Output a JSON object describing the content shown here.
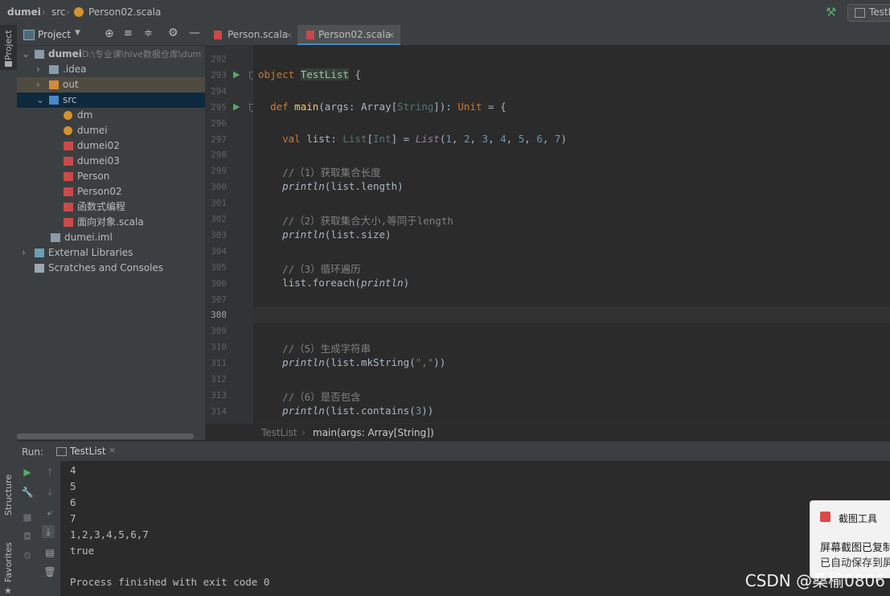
{
  "breadcrumb": {
    "project": "dumei",
    "folder": "src",
    "file": "Person02.scala"
  },
  "run_config": "TestL",
  "left_strip": {
    "project": "Project",
    "structure": "Structure",
    "favorites": "Favorites"
  },
  "project_panel": {
    "title": "Project",
    "items": [
      {
        "label": "dumei",
        "path": "D:\\专业课\\hive数据仓库\\dum",
        "arrow": "⌄",
        "icon": "folder-icon"
      },
      {
        "label": ".idea",
        "arrow": "›",
        "icon": "folder-icon"
      },
      {
        "label": "out",
        "arrow": "›",
        "icon": "folder-orange-icon"
      },
      {
        "label": "src",
        "arrow": "⌄",
        "icon": "folder-blue-icon"
      },
      {
        "label": "dm",
        "icon": "scala-object-icon"
      },
      {
        "label": "dumei",
        "icon": "scala-object-icon"
      },
      {
        "label": "dumei02",
        "icon": "scala-file-icon"
      },
      {
        "label": "dumei03",
        "icon": "scala-file-icon"
      },
      {
        "label": "Person",
        "icon": "scala-file-icon"
      },
      {
        "label": "Person02",
        "icon": "scala-file-icon"
      },
      {
        "label": "函数式编程",
        "icon": "scala-file-icon"
      },
      {
        "label": "面向对象.scala",
        "icon": "scala-file-error-icon"
      },
      {
        "label": "dumei.iml",
        "icon": "iml-file-icon"
      },
      {
        "label": "External Libraries",
        "arrow": "›",
        "icon": "library-icon"
      },
      {
        "label": "Scratches and Consoles",
        "icon": "scratches-icon"
      }
    ]
  },
  "tabs": [
    {
      "label": "Person.scala",
      "active": false
    },
    {
      "label": "Person02.scala",
      "active": true
    }
  ],
  "editor": {
    "lines": [
      {
        "num": "292",
        "text": ""
      },
      {
        "num": "293",
        "tokens": [
          [
            "kw",
            "object "
          ],
          [
            "hl",
            "TestList"
          ],
          [
            "pl",
            " {"
          ]
        ]
      },
      {
        "num": "294",
        "text": ""
      },
      {
        "num": "295",
        "tokens": [
          [
            "pl",
            "  "
          ],
          [
            "kw",
            "def "
          ],
          [
            "fn",
            "main"
          ],
          [
            "pl",
            "(args: Array["
          ],
          [
            "ty",
            "String"
          ],
          [
            "pl",
            "]): "
          ],
          [
            "kw",
            "Unit"
          ],
          [
            "pl",
            " = {"
          ]
        ]
      },
      {
        "num": "296",
        "text": ""
      },
      {
        "num": "297",
        "tokens": [
          [
            "pl",
            "    "
          ],
          [
            "kw",
            "val "
          ],
          [
            "pl",
            "list: "
          ],
          [
            "ty",
            "List"
          ],
          [
            "pl",
            "["
          ],
          [
            "ty",
            "Int"
          ],
          [
            "pl",
            "] = "
          ],
          [
            "it",
            "List"
          ],
          [
            "pl",
            "("
          ],
          [
            "nm",
            "1"
          ],
          [
            "pl",
            ", "
          ],
          [
            "nm",
            "2"
          ],
          [
            "pl",
            ", "
          ],
          [
            "nm",
            "3"
          ],
          [
            "pl",
            ", "
          ],
          [
            "nm",
            "4"
          ],
          [
            "pl",
            ", "
          ],
          [
            "nm",
            "5"
          ],
          [
            "pl",
            ", "
          ],
          [
            "nm",
            "6"
          ],
          [
            "pl",
            ", "
          ],
          [
            "nm",
            "7"
          ],
          [
            "pl",
            ")"
          ]
        ]
      },
      {
        "num": "298",
        "text": ""
      },
      {
        "num": "299",
        "tokens": [
          [
            "pl",
            "    "
          ],
          [
            "cm",
            "//（1）获取集合长度"
          ]
        ]
      },
      {
        "num": "300",
        "tokens": [
          [
            "pl",
            "    "
          ],
          [
            "pi",
            "println"
          ],
          [
            "pl",
            "(list.length)"
          ]
        ]
      },
      {
        "num": "301",
        "text": ""
      },
      {
        "num": "302",
        "tokens": [
          [
            "pl",
            "    "
          ],
          [
            "cm",
            "//（2）获取集合大小,等同于length"
          ]
        ]
      },
      {
        "num": "303",
        "tokens": [
          [
            "pl",
            "    "
          ],
          [
            "pi",
            "println"
          ],
          [
            "pl",
            "(list.size)"
          ]
        ]
      },
      {
        "num": "304",
        "text": ""
      },
      {
        "num": "305",
        "tokens": [
          [
            "pl",
            "    "
          ],
          [
            "cm",
            "//（3）循环遍历"
          ]
        ]
      },
      {
        "num": "306",
        "tokens": [
          [
            "pl",
            "    list.foreach("
          ],
          [
            "pi",
            "println"
          ],
          [
            "pl",
            ")"
          ]
        ]
      },
      {
        "num": "307",
        "text": ""
      },
      {
        "num": "308",
        "text": "",
        "current": true
      },
      {
        "num": "309",
        "text": ""
      },
      {
        "num": "310",
        "tokens": [
          [
            "pl",
            "    "
          ],
          [
            "cm",
            "//（5）生成字符串"
          ]
        ]
      },
      {
        "num": "311",
        "tokens": [
          [
            "pl",
            "    "
          ],
          [
            "pi",
            "println"
          ],
          [
            "pl",
            "(list.mkString("
          ],
          [
            "st",
            "\",\""
          ],
          [
            "pl",
            "))"
          ]
        ]
      },
      {
        "num": "312",
        "text": ""
      },
      {
        "num": "313",
        "tokens": [
          [
            "pl",
            "    "
          ],
          [
            "cm",
            "//（6）是否包含"
          ]
        ]
      },
      {
        "num": "314",
        "tokens": [
          [
            "pl",
            "    "
          ],
          [
            "pi",
            "println"
          ],
          [
            "pl",
            "(list.contains("
          ],
          [
            "nm",
            "3"
          ],
          [
            "pl",
            "))"
          ]
        ]
      }
    ],
    "run_gutter_lines": [
      "293",
      "295"
    ]
  },
  "editor_crumbs": {
    "first": "TestList",
    "second": "main(args: Array[String])"
  },
  "run_panel": {
    "label": "Run:",
    "tab": "TestList",
    "output": [
      "4",
      "5",
      "6",
      "7",
      "1,2,3,4,5,6,7",
      "true",
      "",
      "Process finished with exit code 0"
    ]
  },
  "notification": {
    "app": "截图工具",
    "line1": "屏幕截图已复制",
    "line2": "已自动保存到屏"
  },
  "watermark": "CSDN @桑榆0806",
  "colors": {
    "keyword": "#cc7832",
    "function": "#ffc66d",
    "type": "#507874",
    "number": "#6897bb",
    "comment": "#808080",
    "string": "#6a8759",
    "plain": "#a9b7c6",
    "highlight_bg": "#344134"
  }
}
